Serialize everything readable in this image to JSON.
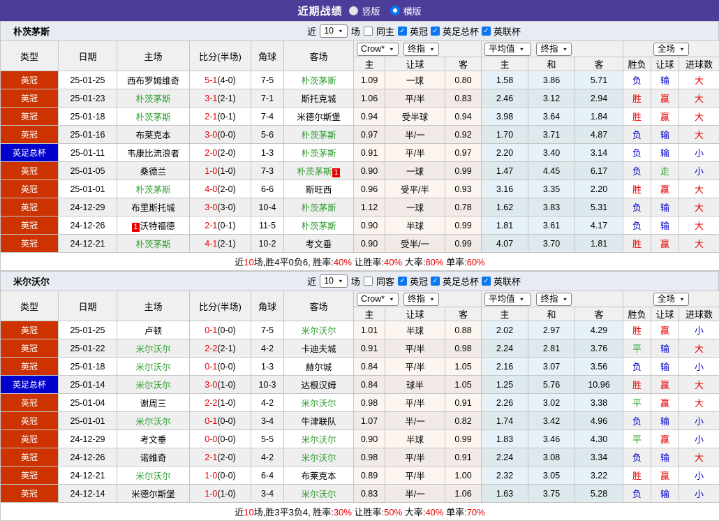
{
  "colors": {
    "topbar": "#4C3D99",
    "league_badge": "#CC3300",
    "cup_badge": "#0000CC",
    "focal_team": "#2E9B2E",
    "win_red": "#E60000",
    "lose_blue": "#0000CC",
    "draw_green": "#1F9E1F",
    "accent_blue": "#0B76EF"
  },
  "topbar": {
    "title": "近期战绩",
    "radios": [
      {
        "label": "竖版",
        "selected": false
      },
      {
        "label": "横版",
        "selected": true
      }
    ]
  },
  "controls": {
    "near_label": "近",
    "near_value": "10",
    "matches_label": "场",
    "bookmaker": "Crow*",
    "index_type": "终指",
    "average": "平均值",
    "index_type2": "终指",
    "fulltime": "全场"
  },
  "table_headers": {
    "left": [
      "类型",
      "日期",
      "主场",
      "比分(半场)",
      "角球",
      "客场"
    ],
    "sub": [
      "主",
      "让球",
      "客",
      "主",
      "和",
      "客",
      "胜负",
      "让球",
      "进球数"
    ]
  },
  "sections": [
    {
      "team": "朴茨茅斯",
      "same_side_label": "同主",
      "same_side_checked": false,
      "competitions": [
        {
          "label": "英冠",
          "checked": true
        },
        {
          "label": "英足总杯",
          "checked": true
        },
        {
          "label": "英联杯",
          "checked": true
        }
      ],
      "rows": [
        {
          "comp": "英冠",
          "comp_color": "red",
          "date": "25-01-25",
          "home": "西布罗姆维奇",
          "home_focal": false,
          "home_card": "",
          "ft": "5-1",
          "ht": "(4-0)",
          "corners": "7-5",
          "away": "朴茨茅斯",
          "away_focal": true,
          "away_card": "",
          "crow": [
            "1.09",
            "一球",
            "0.80"
          ],
          "avg": [
            "1.58",
            "3.86",
            "5.71"
          ],
          "results": [
            [
              "负",
              "blue"
            ],
            [
              "输",
              "blue"
            ],
            [
              "大",
              "red"
            ]
          ]
        },
        {
          "comp": "英冠",
          "comp_color": "red",
          "date": "25-01-23",
          "home": "朴茨茅斯",
          "home_focal": true,
          "home_card": "",
          "ft": "3-1",
          "ht": "(2-1)",
          "corners": "7-1",
          "away": "斯托克城",
          "away_focal": false,
          "away_card": "",
          "crow": [
            "1.06",
            "平/半",
            "0.83"
          ],
          "avg": [
            "2.46",
            "3.12",
            "2.94"
          ],
          "results": [
            [
              "胜",
              "red"
            ],
            [
              "赢",
              "red"
            ],
            [
              "大",
              "red"
            ]
          ]
        },
        {
          "comp": "英冠",
          "comp_color": "red",
          "date": "25-01-18",
          "home": "朴茨茅斯",
          "home_focal": true,
          "home_card": "",
          "ft": "2-1",
          "ht": "(0-1)",
          "corners": "7-4",
          "away": "米德尔斯堡",
          "away_focal": false,
          "away_card": "",
          "crow": [
            "0.94",
            "受半球",
            "0.94"
          ],
          "avg": [
            "3.98",
            "3.64",
            "1.84"
          ],
          "results": [
            [
              "胜",
              "red"
            ],
            [
              "赢",
              "red"
            ],
            [
              "大",
              "red"
            ]
          ]
        },
        {
          "comp": "英冠",
          "comp_color": "red",
          "date": "25-01-16",
          "home": "布莱克本",
          "home_focal": false,
          "home_card": "",
          "ft": "3-0",
          "ht": "(0-0)",
          "corners": "5-6",
          "away": "朴茨茅斯",
          "away_focal": true,
          "away_card": "",
          "crow": [
            "0.97",
            "半/一",
            "0.92"
          ],
          "avg": [
            "1.70",
            "3.71",
            "4.87"
          ],
          "results": [
            [
              "负",
              "blue"
            ],
            [
              "输",
              "blue"
            ],
            [
              "大",
              "red"
            ]
          ]
        },
        {
          "comp": "英足总杯",
          "comp_color": "blue",
          "date": "25-01-11",
          "home": "韦康比流浪者",
          "home_focal": false,
          "home_card": "",
          "ft": "2-0",
          "ht": "(2-0)",
          "corners": "1-3",
          "away": "朴茨茅斯",
          "away_focal": true,
          "away_card": "",
          "crow": [
            "0.91",
            "平/半",
            "0.97"
          ],
          "avg": [
            "2.20",
            "3.40",
            "3.14"
          ],
          "results": [
            [
              "负",
              "blue"
            ],
            [
              "输",
              "blue"
            ],
            [
              "小",
              "blue"
            ]
          ]
        },
        {
          "comp": "英冠",
          "comp_color": "red",
          "date": "25-01-05",
          "home": "桑德兰",
          "home_focal": false,
          "home_card": "",
          "ft": "1-0",
          "ht": "(1-0)",
          "corners": "7-3",
          "away": "朴茨茅斯",
          "away_focal": true,
          "away_card": "1",
          "crow": [
            "0.90",
            "一球",
            "0.99"
          ],
          "avg": [
            "1.47",
            "4.45",
            "6.17"
          ],
          "results": [
            [
              "负",
              "blue"
            ],
            [
              "走",
              "green"
            ],
            [
              "小",
              "blue"
            ]
          ]
        },
        {
          "comp": "英冠",
          "comp_color": "red",
          "date": "25-01-01",
          "home": "朴茨茅斯",
          "home_focal": true,
          "home_card": "",
          "ft": "4-0",
          "ht": "(2-0)",
          "corners": "6-6",
          "away": "斯旺西",
          "away_focal": false,
          "away_card": "",
          "crow": [
            "0.96",
            "受平/半",
            "0.93"
          ],
          "avg": [
            "3.16",
            "3.35",
            "2.20"
          ],
          "results": [
            [
              "胜",
              "red"
            ],
            [
              "赢",
              "red"
            ],
            [
              "大",
              "red"
            ]
          ]
        },
        {
          "comp": "英冠",
          "comp_color": "red",
          "date": "24-12-29",
          "home": "布里斯托城",
          "home_focal": false,
          "home_card": "",
          "ft": "3-0",
          "ht": "(3-0)",
          "corners": "10-4",
          "away": "朴茨茅斯",
          "away_focal": true,
          "away_card": "",
          "crow": [
            "1.12",
            "一球",
            "0.78"
          ],
          "avg": [
            "1.62",
            "3.83",
            "5.31"
          ],
          "results": [
            [
              "负",
              "blue"
            ],
            [
              "输",
              "blue"
            ],
            [
              "大",
              "red"
            ]
          ]
        },
        {
          "comp": "英冠",
          "comp_color": "red",
          "date": "24-12-26",
          "home": "沃特福德",
          "home_focal": false,
          "home_card": "1",
          "ft": "2-1",
          "ht": "(0-1)",
          "corners": "11-5",
          "away": "朴茨茅斯",
          "away_focal": true,
          "away_card": "",
          "crow": [
            "0.90",
            "半球",
            "0.99"
          ],
          "avg": [
            "1.81",
            "3.61",
            "4.17"
          ],
          "results": [
            [
              "负",
              "blue"
            ],
            [
              "输",
              "blue"
            ],
            [
              "大",
              "red"
            ]
          ]
        },
        {
          "comp": "英冠",
          "comp_color": "red",
          "date": "24-12-21",
          "home": "朴茨茅斯",
          "home_focal": true,
          "home_card": "",
          "ft": "4-1",
          "ht": "(2-1)",
          "corners": "10-2",
          "away": "考文垂",
          "away_focal": false,
          "away_card": "",
          "crow": [
            "0.90",
            "受半/一",
            "0.99"
          ],
          "avg": [
            "4.07",
            "3.70",
            "1.81"
          ],
          "results": [
            [
              "胜",
              "red"
            ],
            [
              "赢",
              "red"
            ],
            [
              "大",
              "red"
            ]
          ]
        }
      ],
      "summary": [
        [
          "近",
          "k"
        ],
        [
          "10",
          "r"
        ],
        [
          "场,胜4平0负6, 胜率:",
          "k"
        ],
        [
          "40%",
          "r"
        ],
        [
          " 让胜率:",
          "k"
        ],
        [
          "40%",
          "r"
        ],
        [
          " 大率:",
          "k"
        ],
        [
          "80%",
          "r"
        ],
        [
          " 单率:",
          "k"
        ],
        [
          "60%",
          "r"
        ]
      ]
    },
    {
      "team": "米尔沃尔",
      "same_side_label": "同客",
      "same_side_checked": false,
      "competitions": [
        {
          "label": "英冠",
          "checked": true
        },
        {
          "label": "英足总杯",
          "checked": true
        },
        {
          "label": "英联杯",
          "checked": true
        }
      ],
      "rows": [
        {
          "comp": "英冠",
          "comp_color": "red",
          "date": "25-01-25",
          "home": "卢顿",
          "home_focal": false,
          "home_card": "",
          "ft": "0-1",
          "ht": "(0-0)",
          "corners": "7-5",
          "away": "米尔沃尔",
          "away_focal": true,
          "away_card": "",
          "crow": [
            "1.01",
            "半球",
            "0.88"
          ],
          "avg": [
            "2.02",
            "2.97",
            "4.29"
          ],
          "results": [
            [
              "胜",
              "red"
            ],
            [
              "赢",
              "red"
            ],
            [
              "小",
              "blue"
            ]
          ]
        },
        {
          "comp": "英冠",
          "comp_color": "red",
          "date": "25-01-22",
          "home": "米尔沃尔",
          "home_focal": true,
          "home_card": "",
          "ft": "2-2",
          "ht": "(2-1)",
          "corners": "4-2",
          "away": "卡迪夫城",
          "away_focal": false,
          "away_card": "",
          "crow": [
            "0.91",
            "平/半",
            "0.98"
          ],
          "avg": [
            "2.24",
            "2.81",
            "3.76"
          ],
          "results": [
            [
              "平",
              "green"
            ],
            [
              "输",
              "blue"
            ],
            [
              "大",
              "red"
            ]
          ]
        },
        {
          "comp": "英冠",
          "comp_color": "red",
          "date": "25-01-18",
          "home": "米尔沃尔",
          "home_focal": true,
          "home_card": "",
          "ft": "0-1",
          "ht": "(0-0)",
          "corners": "1-3",
          "away": "赫尔城",
          "away_focal": false,
          "away_card": "",
          "crow": [
            "0.84",
            "平/半",
            "1.05"
          ],
          "avg": [
            "2.16",
            "3.07",
            "3.56"
          ],
          "results": [
            [
              "负",
              "blue"
            ],
            [
              "输",
              "blue"
            ],
            [
              "小",
              "blue"
            ]
          ]
        },
        {
          "comp": "英足总杯",
          "comp_color": "blue",
          "date": "25-01-14",
          "home": "米尔沃尔",
          "home_focal": true,
          "home_card": "",
          "ft": "3-0",
          "ht": "(1-0)",
          "corners": "10-3",
          "away": "达根汉姆",
          "away_focal": false,
          "away_card": "",
          "crow": [
            "0.84",
            "球半",
            "1.05"
          ],
          "avg": [
            "1.25",
            "5.76",
            "10.96"
          ],
          "results": [
            [
              "胜",
              "red"
            ],
            [
              "赢",
              "red"
            ],
            [
              "大",
              "red"
            ]
          ]
        },
        {
          "comp": "英冠",
          "comp_color": "red",
          "date": "25-01-04",
          "home": "谢周三",
          "home_focal": false,
          "home_card": "",
          "ft": "2-2",
          "ht": "(1-0)",
          "corners": "4-2",
          "away": "米尔沃尔",
          "away_focal": true,
          "away_card": "",
          "crow": [
            "0.98",
            "平/半",
            "0.91"
          ],
          "avg": [
            "2.26",
            "3.02",
            "3.38"
          ],
          "results": [
            [
              "平",
              "green"
            ],
            [
              "赢",
              "red"
            ],
            [
              "大",
              "red"
            ]
          ]
        },
        {
          "comp": "英冠",
          "comp_color": "red",
          "date": "25-01-01",
          "home": "米尔沃尔",
          "home_focal": true,
          "home_card": "",
          "ft": "0-1",
          "ht": "(0-0)",
          "corners": "3-4",
          "away": "牛津联队",
          "away_focal": false,
          "away_card": "",
          "crow": [
            "1.07",
            "半/一",
            "0.82"
          ],
          "avg": [
            "1.74",
            "3.42",
            "4.96"
          ],
          "results": [
            [
              "负",
              "blue"
            ],
            [
              "输",
              "blue"
            ],
            [
              "小",
              "blue"
            ]
          ]
        },
        {
          "comp": "英冠",
          "comp_color": "red",
          "date": "24-12-29",
          "home": "考文垂",
          "home_focal": false,
          "home_card": "",
          "ft": "0-0",
          "ht": "(0-0)",
          "corners": "5-5",
          "away": "米尔沃尔",
          "away_focal": true,
          "away_card": "",
          "crow": [
            "0.90",
            "半球",
            "0.99"
          ],
          "avg": [
            "1.83",
            "3.46",
            "4.30"
          ],
          "results": [
            [
              "平",
              "green"
            ],
            [
              "赢",
              "red"
            ],
            [
              "小",
              "blue"
            ]
          ]
        },
        {
          "comp": "英冠",
          "comp_color": "red",
          "date": "24-12-26",
          "home": "诺维奇",
          "home_focal": false,
          "home_card": "",
          "ft": "2-1",
          "ht": "(2-0)",
          "corners": "4-2",
          "away": "米尔沃尔",
          "away_focal": true,
          "away_card": "",
          "crow": [
            "0.98",
            "平/半",
            "0.91"
          ],
          "avg": [
            "2.24",
            "3.08",
            "3.34"
          ],
          "results": [
            [
              "负",
              "blue"
            ],
            [
              "输",
              "blue"
            ],
            [
              "大",
              "red"
            ]
          ]
        },
        {
          "comp": "英冠",
          "comp_color": "red",
          "date": "24-12-21",
          "home": "米尔沃尔",
          "home_focal": true,
          "home_card": "",
          "ft": "1-0",
          "ht": "(0-0)",
          "corners": "6-4",
          "away": "布莱克本",
          "away_focal": false,
          "away_card": "",
          "crow": [
            "0.89",
            "平/半",
            "1.00"
          ],
          "avg": [
            "2.32",
            "3.05",
            "3.22"
          ],
          "results": [
            [
              "胜",
              "red"
            ],
            [
              "赢",
              "red"
            ],
            [
              "小",
              "blue"
            ]
          ]
        },
        {
          "comp": "英冠",
          "comp_color": "red",
          "date": "24-12-14",
          "home": "米德尔斯堡",
          "home_focal": false,
          "home_card": "",
          "ft": "1-0",
          "ht": "(1-0)",
          "corners": "3-4",
          "away": "米尔沃尔",
          "away_focal": true,
          "away_card": "",
          "crow": [
            "0.83",
            "半/一",
            "1.06"
          ],
          "avg": [
            "1.63",
            "3.75",
            "5.28"
          ],
          "results": [
            [
              "负",
              "blue"
            ],
            [
              "输",
              "blue"
            ],
            [
              "小",
              "blue"
            ]
          ]
        }
      ],
      "summary": [
        [
          "近",
          "k"
        ],
        [
          "10",
          "r"
        ],
        [
          "场,胜3平3负4, 胜率:",
          "k"
        ],
        [
          "30%",
          "r"
        ],
        [
          " 让胜率:",
          "k"
        ],
        [
          "50%",
          "r"
        ],
        [
          " 大率:",
          "k"
        ],
        [
          "40%",
          "r"
        ],
        [
          " 单率:",
          "k"
        ],
        [
          "70%",
          "r"
        ]
      ]
    }
  ]
}
